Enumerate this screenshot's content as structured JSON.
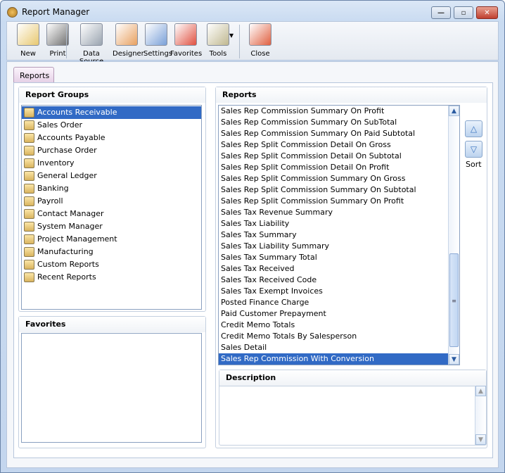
{
  "window": {
    "title": "Report Manager",
    "controls": [
      "minimize",
      "maximize",
      "close"
    ]
  },
  "toolbar": [
    {
      "label": "New",
      "icon": "new-report-icon",
      "color": "#e8c870"
    },
    {
      "label": "Print",
      "icon": "printer-icon",
      "color": "#707070"
    },
    {
      "label": "Data Source",
      "icon": "database-icon",
      "color": "#9aa4b0"
    },
    {
      "label": "Designer",
      "icon": "designer-icon",
      "color": "#e8a060"
    },
    {
      "label": "Settings",
      "icon": "settings-icon",
      "color": "#7aa0d8"
    },
    {
      "label": "Favorites",
      "icon": "favorites-icon",
      "color": "#e05040"
    },
    {
      "label": "Tools",
      "icon": "tools-icon",
      "color": "#c0b890"
    },
    {
      "label": "Close",
      "icon": "close-report-icon",
      "color": "#e06040"
    }
  ],
  "tab": "Reports",
  "report_groups": {
    "title": "Report Groups",
    "selected": 0,
    "items": [
      "Accounts Receivable",
      "Sales Order",
      "Accounts Payable",
      "Purchase Order",
      "Inventory",
      "General Ledger",
      "Banking",
      "Payroll",
      "Contact Manager",
      "System Manager",
      "Project Management",
      "Manufacturing",
      "Custom Reports",
      "Recent Reports"
    ]
  },
  "favorites": {
    "title": "Favorites",
    "items": []
  },
  "reports": {
    "title": "Reports",
    "selected": 22,
    "items": [
      "Sales Rep Commission Summary On Profit",
      "Sales Rep Commission Summary On SubTotal",
      "Sales Rep Commission Summary On Paid Subtotal",
      "Sales Rep Split Commission Detail On Gross",
      "Sales Rep Split Commission Detail On Subtotal",
      "Sales Rep Split Commission Detail On Profit",
      "Sales Rep Split Commission Summary On Gross",
      "Sales Rep Split Commission Summary On Subtotal",
      "Sales Rep Split Commission Summary On Profit",
      "Sales Tax Revenue Summary",
      "Sales Tax Liability",
      "Sales Tax Summary",
      "Sales Tax Liability Summary",
      "Sales Tax Summary Total",
      "Sales Tax Received",
      "Sales Tax Received Code",
      "Sales Tax Exempt Invoices",
      "Posted Finance Charge",
      "Paid Customer Prepayment",
      "Credit Memo Totals",
      "Credit Memo Totals By Salesperson",
      "Sales Detail",
      "Sales Rep Commission With Conversion"
    ]
  },
  "sort": {
    "label": "Sort"
  },
  "description": {
    "title": "Description",
    "value": ""
  }
}
